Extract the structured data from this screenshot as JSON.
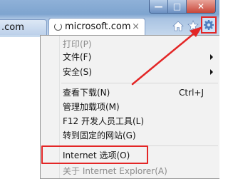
{
  "tabs": {
    "previous_tab_label": ".com",
    "active_tab_label": "microsoft.com",
    "close_glyph": "×"
  },
  "window_controls": {
    "minimize_glyph": "—",
    "maximize_glyph": "□",
    "close_glyph": "✕"
  },
  "toolbar": {
    "home_icon": "home-icon",
    "favorites_icon": "star-icon",
    "tools_icon": "gear-icon"
  },
  "menu": {
    "items": [
      {
        "label": "打印(P)",
        "disabled": true,
        "has_submenu": false,
        "shortcut": ""
      },
      {
        "label": "文件(F)",
        "disabled": false,
        "has_submenu": true,
        "shortcut": ""
      },
      {
        "label": "安全(S)",
        "disabled": false,
        "has_submenu": true,
        "shortcut": ""
      },
      {
        "label": "查看下载(N)",
        "disabled": false,
        "has_submenu": false,
        "shortcut": "Ctrl+J"
      },
      {
        "label": "管理加载项(M)",
        "disabled": false,
        "has_submenu": false,
        "shortcut": ""
      },
      {
        "label": "F12 开发人员工具(L)",
        "disabled": false,
        "has_submenu": false,
        "shortcut": ""
      },
      {
        "label": "转到固定的网站(G)",
        "disabled": false,
        "has_submenu": false,
        "shortcut": ""
      },
      {
        "label": "Internet 选项(O)",
        "disabled": false,
        "has_submenu": false,
        "shortcut": ""
      },
      {
        "label": "关于 Internet Explorer(A)",
        "disabled": true,
        "has_submenu": false,
        "shortcut": ""
      }
    ]
  },
  "annotation_color": "#e32626"
}
